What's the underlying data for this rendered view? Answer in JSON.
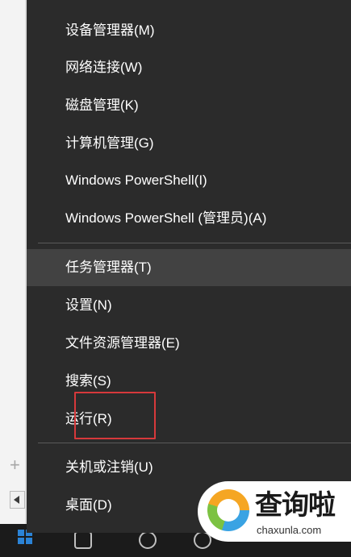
{
  "menu": {
    "items": [
      {
        "label": "设备管理器(M)"
      },
      {
        "label": "网络连接(W)"
      },
      {
        "label": "磁盘管理(K)"
      },
      {
        "label": "计算机管理(G)"
      },
      {
        "label": "Windows PowerShell(I)"
      },
      {
        "label": "Windows PowerShell (管理员)(A)"
      },
      {
        "label": "任务管理器(T)"
      },
      {
        "label": "设置(N)"
      },
      {
        "label": "文件资源管理器(E)"
      },
      {
        "label": "搜索(S)"
      },
      {
        "label": "运行(R)"
      },
      {
        "label": "关机或注销(U)"
      },
      {
        "label": "桌面(D)"
      }
    ],
    "highlighted_item": "任务管理器(T)",
    "annotated_item": "运行(R)"
  },
  "colors": {
    "menu_bg": "#2b2b2b",
    "highlight_bg": "#424242",
    "annotation": "#d7393b",
    "taskbar": "#1b1b1b"
  },
  "watermark": {
    "logo_text": "查询啦",
    "url": "chaxunla.com"
  }
}
